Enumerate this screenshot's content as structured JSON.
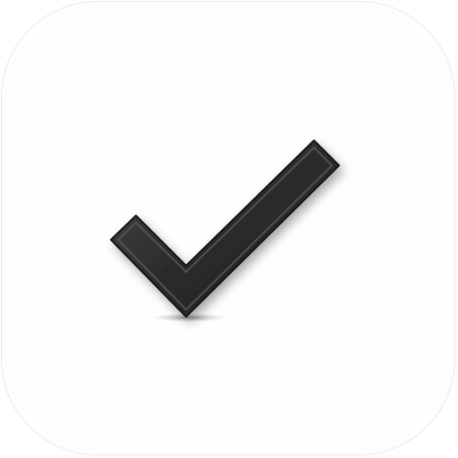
{
  "icon": {
    "name": "checkmark-icon",
    "background_color": "#fefefe",
    "border_color": "#e9e9e9",
    "mark_color": "#2b2b2b",
    "mark_highlight_color": "#5a5a5a",
    "shadow_color": "#9a9a9a"
  }
}
